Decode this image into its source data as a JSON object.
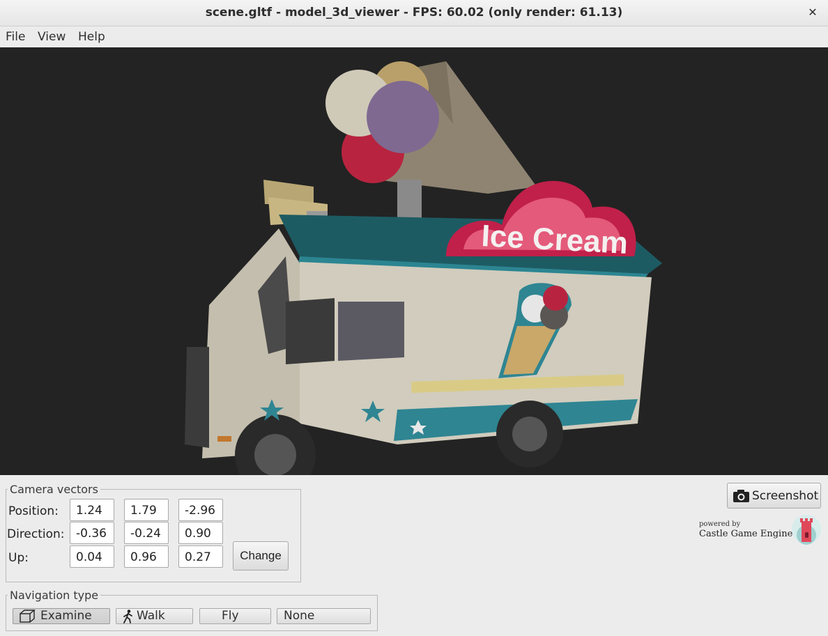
{
  "window": {
    "title": "scene.gltf - model_3d_viewer - FPS: 60.02 (only render: 61.13)",
    "close_icon": "close-icon"
  },
  "menu": [
    "File",
    "View",
    "Help"
  ],
  "viewport": {
    "background": "#232323",
    "scene_sign_text": "Ice Cream"
  },
  "camera": {
    "group_title": "Camera vectors",
    "rows": [
      {
        "label": "Position:",
        "values": [
          "1.24",
          "1.79",
          "-2.96"
        ]
      },
      {
        "label": "Direction:",
        "values": [
          "-0.36",
          "-0.24",
          "0.90"
        ]
      },
      {
        "label": "Up:",
        "values": [
          "0.04",
          "0.96",
          "0.27"
        ]
      }
    ],
    "change_button": "Change"
  },
  "navigation": {
    "group_title": "Navigation type",
    "buttons": [
      {
        "label": "Examine",
        "icon": "cube-icon",
        "active": true
      },
      {
        "label": "Walk",
        "icon": "walking-person-icon",
        "active": false
      },
      {
        "label": "Fly",
        "icon": "",
        "active": false
      },
      {
        "label": "None",
        "icon": "",
        "active": false
      }
    ]
  },
  "screenshot_button": {
    "label": "Screenshot",
    "icon": "camera-icon"
  },
  "branding": {
    "powered_by": "powered by",
    "engine": "Castle Game Engine",
    "logo_icon": "castle-tower-icon"
  }
}
